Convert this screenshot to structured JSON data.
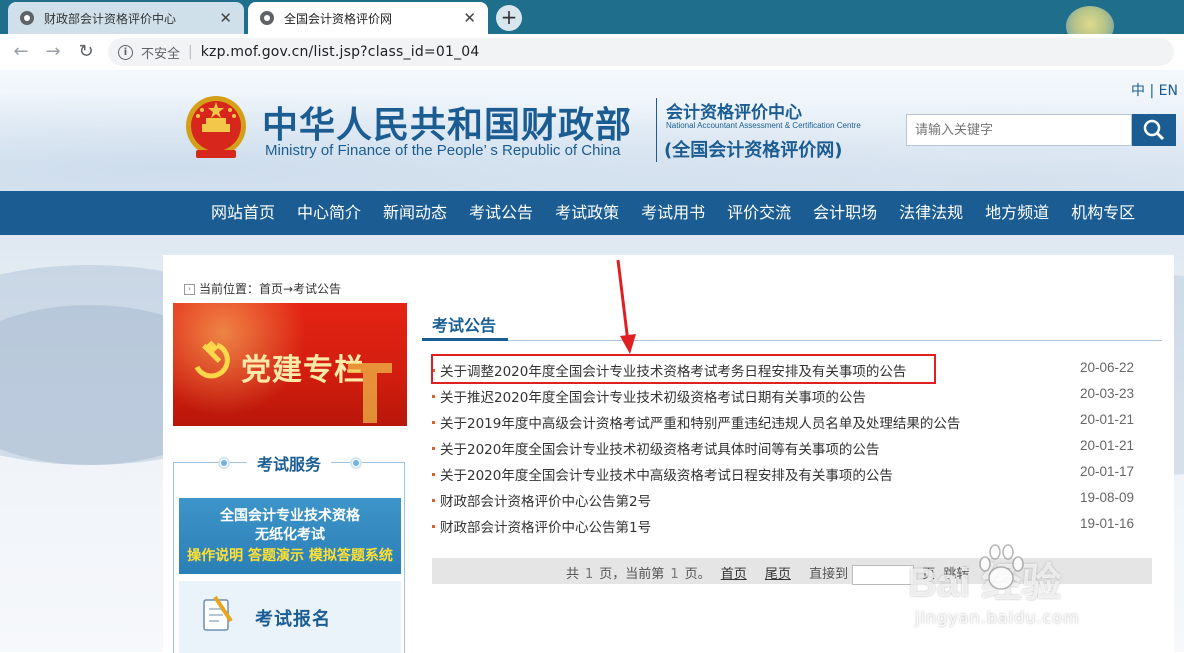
{
  "browser": {
    "tabs": [
      {
        "title": "财政部会计资格评价中心",
        "active": false
      },
      {
        "title": "全国会计资格评价网",
        "active": true
      }
    ],
    "new_tab": "+",
    "close": "✕",
    "address": {
      "security_label": "不安全",
      "url": "kzp.mof.gov.cn/list.jsp?class_id=01_04"
    }
  },
  "header": {
    "title_cn": "中华人民共和国财政部",
    "title_en": "Ministry of Finance of the People’ s Republic of China",
    "center_cn": "会计资格评价中心",
    "center_en": "National Accountant Assessment & Certification Centre",
    "center_site": "(全国会计资格评价网)",
    "lang": "中 | EN",
    "search_placeholder": "请输入关键字"
  },
  "nav": [
    "网站首页",
    "中心简介",
    "新闻动态",
    "考试公告",
    "考试政策",
    "考试用书",
    "评价交流",
    "会计职场",
    "法律法规",
    "地方频道",
    "机构专区"
  ],
  "breadcrumb": "当前位置：首页→考试公告",
  "sidebar": {
    "party_banner": "党建专栏",
    "service_title": "考试服务",
    "paperless_line1": "全国会计专业技术资格",
    "paperless_line2": "无纸化考试",
    "paperless_line3": "操作说明 答题演示 模拟答题系统",
    "register_label": "考试报名"
  },
  "section_title": "考试公告",
  "notices": [
    {
      "title": "关于调整2020年度全国会计专业技术资格考试考务日程安排及有关事项的公告",
      "date": "20-06-22"
    },
    {
      "title": "关于推迟2020年度全国会计专业技术初级资格考试日期有关事项的公告",
      "date": "20-03-23"
    },
    {
      "title": "关于2019年度中高级会计资格考试严重和特别严重违纪违规人员名单及处理结果的公告",
      "date": "20-01-21"
    },
    {
      "title": "关于2020年度全国会计专业技术初级资格考试具体时间等有关事项的公告",
      "date": "20-01-21"
    },
    {
      "title": "关于2020年度全国会计专业技术中高级资格考试日程安排及有关事项的公告",
      "date": "20-01-17"
    },
    {
      "title": "财政部会计资格评价中心公告第2号",
      "date": "19-08-09"
    },
    {
      "title": "财政部会计资格评价中心公告第1号",
      "date": "19-01-16"
    }
  ],
  "pager": {
    "total_prefix": "共",
    "total_pages": "1",
    "total_suffix": "页，当前第",
    "current": "1",
    "current_suffix": "页。",
    "first": "首页",
    "last": "尾页",
    "jump_label": "直接到",
    "jump_suffix": "页",
    "go": "跳转"
  },
  "watermark": {
    "text": "Bai  经验",
    "sub": "jingyan.baidu.com"
  },
  "colors": {
    "brand_blue": "#1b5d93",
    "tabbar": "#1f6e8c",
    "highlight": "#e02020",
    "party_red": "#d11d0f"
  }
}
